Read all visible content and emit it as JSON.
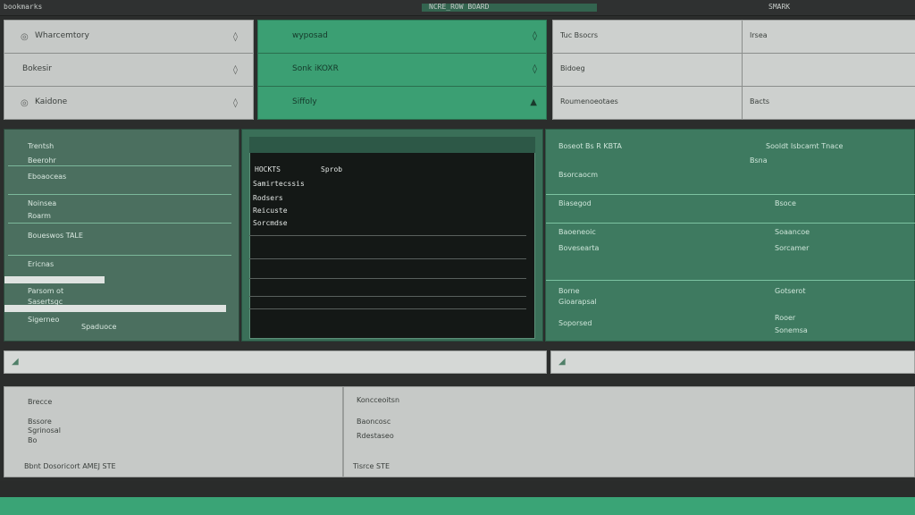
{
  "topbar": {
    "left_label": "bookmarks",
    "center_label": "NCRE_ROW BOARD",
    "right_label": "SMARK"
  },
  "colors": {
    "accent_green": "#3aa476",
    "panel_grey": "#c8cbc9",
    "dark_bg": "#2b2d2c"
  },
  "left_list": {
    "items": [
      {
        "label": "Wharcemtory"
      },
      {
        "label": "Bokesir"
      },
      {
        "label": "Kaidone"
      }
    ]
  },
  "green_list": {
    "items": [
      {
        "label": "wyposad"
      },
      {
        "label": "Sonk iKOXR"
      },
      {
        "label": "Siffoly"
      }
    ]
  },
  "right_table": {
    "rows": [
      {
        "c1": "Tuc Bsocrs",
        "c2": "Irsea"
      },
      {
        "c1": "Bidoeg",
        "c2": ""
      },
      {
        "c1": "Roumenoeotaes",
        "c2": "Bacts"
      }
    ]
  },
  "left_panel": {
    "title": "Trentsh",
    "items": [
      {
        "label": "Beerohr"
      },
      {
        "label": "Eboaoceas"
      },
      {
        "label": "Noinsea"
      },
      {
        "label": "Roarm"
      },
      {
        "label": "Boueswos TALE"
      },
      {
        "label": "Ericnas"
      },
      {
        "label": "Parsom ot"
      },
      {
        "label": "Sasertsgc"
      },
      {
        "label": "Sigerneo"
      },
      {
        "label": "Spaduoce"
      }
    ]
  },
  "center_panel": {
    "header_left": "HOCKTS",
    "header_right": "Sprob",
    "rows": [
      "Samirtecssis",
      "Rodsers",
      "Reicuste",
      "Sorcmdse"
    ]
  },
  "right_panel": {
    "title": "Boseot Bs R KBTA",
    "subtitle": "Bsorcaocm",
    "col2_title": "Sooldt Isbcamt Tnace",
    "col2_sub": "Bsna",
    "items_left": [
      "Biasegod",
      "Baoeneoic",
      "Bovesearta",
      "Borne",
      "Gioarapsal",
      "Soporsed"
    ],
    "items_right": [
      "Bsoce",
      "Soaancoe",
      "Sorcamer",
      "Gotserot",
      "Rooer",
      "Sonemsa"
    ]
  },
  "bottom": {
    "left_title": "Brecce",
    "left_lines": [
      "Bssore",
      "Sgrinosal",
      "Bo"
    ],
    "left_footer": "Bbnt Dosoricort AMEJ STE",
    "right_lines": [
      "Koncceoitsn",
      "Baoncosc",
      "Rdestaseo"
    ],
    "right_footer": "Tisrce STE"
  }
}
